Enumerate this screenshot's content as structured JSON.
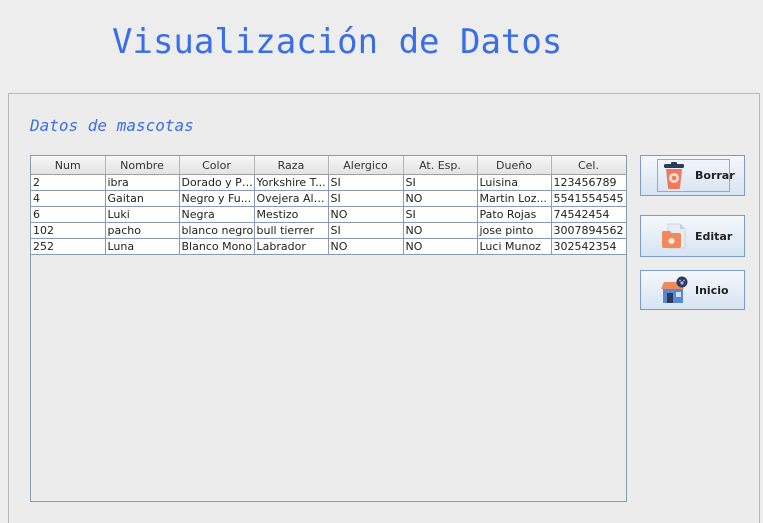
{
  "header": {
    "title": "Visualización de Datos"
  },
  "section": {
    "title": "Datos de mascotas"
  },
  "table": {
    "columns": [
      "Num",
      "Nombre",
      "Color",
      "Raza",
      "Alergico",
      "At. Esp.",
      "Dueño",
      "Cel."
    ],
    "rows": [
      [
        "2",
        "ibra",
        "Dorado y Pl...",
        "Yorkshire T...",
        "SI",
        "SI",
        "Luisina",
        "123456789"
      ],
      [
        "4",
        "Gaitan",
        "Negro y Fu...",
        "Ovejera Ale...",
        "SI",
        "NO",
        "Martin Loz...",
        "5541554545"
      ],
      [
        "6",
        "Luki",
        "Negra",
        "Mestizo",
        "NO",
        "SI",
        "Pato Rojas",
        "74542454"
      ],
      [
        "102",
        "pacho",
        "blanco negro",
        "bull tierrer",
        "SI",
        "NO",
        "jose pinto",
        "3007894562"
      ],
      [
        "252",
        "Luna",
        "Blanco Mono",
        "Labrador",
        "NO",
        "NO",
        "Luci Munoz",
        "302542354"
      ]
    ]
  },
  "buttons": {
    "borrar": {
      "label": "Borrar",
      "icon": "trash-icon"
    },
    "editar": {
      "label": "Editar",
      "icon": "file-edit-icon"
    },
    "inicio": {
      "label": "Inicio",
      "icon": "home-icon"
    }
  }
}
